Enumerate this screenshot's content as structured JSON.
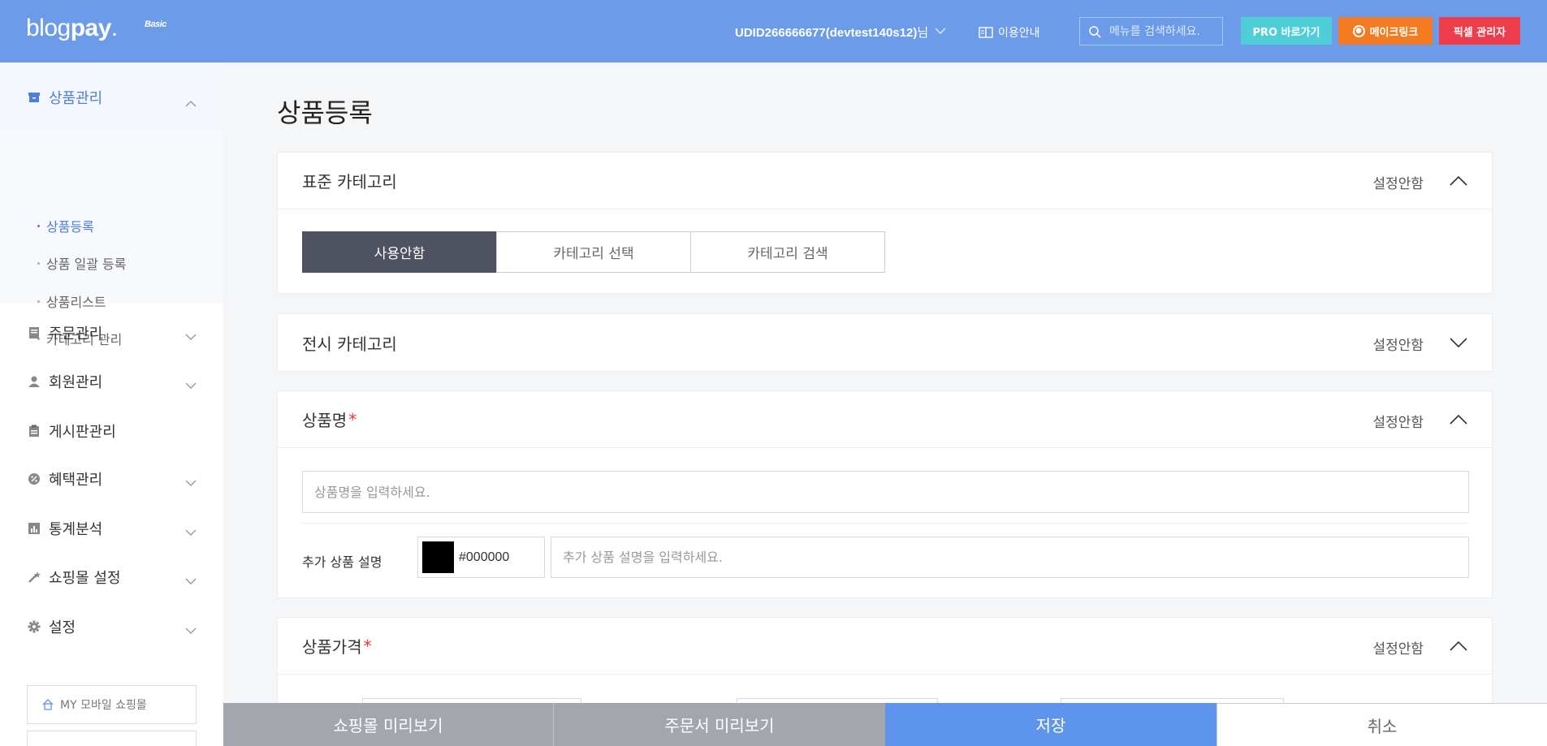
{
  "header": {
    "logo": {
      "text": "blog",
      "bold": "pay",
      "dot": ".",
      "badge": "Basic"
    },
    "user": {
      "id": "UDID266666677(devtest140s12)",
      "suffix": "님"
    },
    "guide_label": "이용안내",
    "search_placeholder": "메뉴를 검색하세요.",
    "pro_label": "PRO 바로가기",
    "make_label": "메이크링크",
    "admin_label": "픽셀 관리자",
    "colors": {
      "bg": "#6b9be9",
      "pro": "#4ecfd8",
      "make": "#f47c20",
      "admin": "#ef3c4a"
    }
  },
  "sidebar": {
    "items": [
      {
        "label": "상품관리",
        "icon": "box-icon",
        "expanded": true
      },
      {
        "label": "주문관리",
        "icon": "document-icon"
      },
      {
        "label": "회원관리",
        "icon": "person-icon"
      },
      {
        "label": "게시판관리",
        "icon": "clipboard-icon"
      },
      {
        "label": "혜택관리",
        "icon": "percent-icon"
      },
      {
        "label": "통계분석",
        "icon": "bar-chart-icon"
      },
      {
        "label": "쇼핑몰 설정",
        "icon": "wand-icon"
      },
      {
        "label": "설정",
        "icon": "gear-icon"
      }
    ],
    "subitems": [
      "상품등록",
      "상품 일괄 등록",
      "상품리스트",
      "카테고리 관리"
    ],
    "my_shop_label": "MY 모바일 쇼핑몰"
  },
  "main": {
    "title": "상품등록",
    "status_label": "설정안함",
    "std_category": {
      "title": "표준 카테고리",
      "options": [
        "사용안함",
        "카테고리 선택",
        "카테고리 검색"
      ]
    },
    "display_category": {
      "title": "전시 카테고리"
    },
    "product_name": {
      "title": "상품명",
      "required_mark": "*",
      "placeholder": "상품명을 입력하세요.",
      "extra_label": "추가 상품 설명",
      "color_value": "#000000",
      "extra_placeholder": "추가 상품 설명을 입력하세요."
    },
    "price": {
      "title": "상품가격",
      "required_mark": "*"
    }
  },
  "bottom_bar": {
    "preview_label": "쇼핑몰 미리보기",
    "order_preview_label": "주문서 미리보기",
    "save_label": "저장",
    "cancel_label": "취소"
  }
}
